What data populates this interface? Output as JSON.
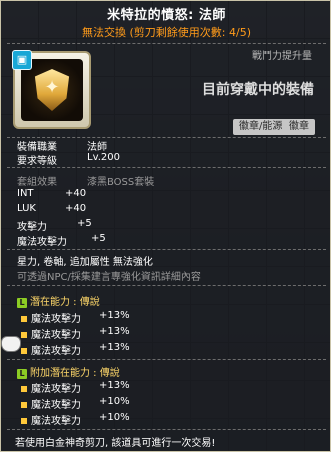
{
  "item": {
    "name": "米特拉的憤怒: 法師",
    "trade_status": "無法交換 (剪刀剩餘使用次數: 4/5)",
    "power_label": "戰鬥力提升量",
    "equipped_label": "目前穿戴中的裝備",
    "chip_left": "徽章/能源",
    "chip_right": "徽章"
  },
  "requirements": [
    {
      "label": "裝備職業",
      "value": "法師"
    },
    {
      "label": "要求等級",
      "value": "Lv.200"
    }
  ],
  "set": {
    "label": "套組效果",
    "value": "漆黑BOSS套裝"
  },
  "stats": [
    {
      "label": "INT",
      "value": "+40"
    },
    {
      "label": "LUK",
      "value": "+40"
    },
    {
      "label": "攻擊力",
      "value": "+5"
    },
    {
      "label": "魔法攻擊力",
      "value": "+5"
    }
  ],
  "notes": [
    "星力, 卷軸, 追加屬性 無法強化",
    "可透過NPC/採集建言專強化資訊詳細內容"
  ],
  "potential": {
    "tag": "L",
    "title": "潛在能力 : 傳說",
    "lines": [
      {
        "label": "魔法攻擊力",
        "value": "+13%"
      },
      {
        "label": "魔法攻擊力",
        "value": "+13%"
      },
      {
        "label": "魔法攻擊力",
        "value": "+13%"
      }
    ]
  },
  "additional_potential": {
    "tag": "L",
    "title": "附加潛在能力 : 傳說",
    "lines": [
      {
        "label": "魔法攻擊力",
        "value": "+13%"
      },
      {
        "label": "魔法攻擊力",
        "value": "+10%"
      },
      {
        "label": "魔法攻擊力",
        "value": "+10%"
      }
    ]
  },
  "footer": "若使用白金神奇剪刀, 該道具可進行一次交易!"
}
